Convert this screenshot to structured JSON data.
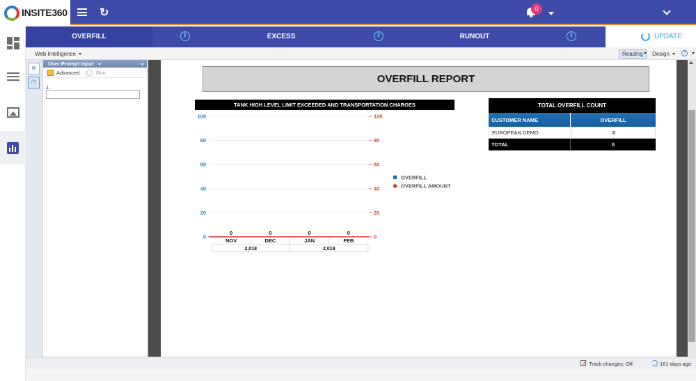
{
  "app": {
    "logo_text": "INSITE360",
    "notification_count": "0"
  },
  "tabs": [
    {
      "label": "OVERFILL"
    },
    {
      "label": "EXCESS"
    },
    {
      "label": "RUNOUT"
    }
  ],
  "update_label": "UPDATE",
  "bi_toolbar": {
    "app_name": "Web Intelligence",
    "reading_label": "Reading",
    "design_label": "Design",
    "help_symbol": "?"
  },
  "prompt_panel": {
    "title": "User Prompt Input",
    "advanced_label": "Advanced",
    "run_label": "Run",
    "prompt_number": "1",
    "prompt_value": ""
  },
  "report": {
    "title": "OVERFILL REPORT"
  },
  "chart_data": {
    "type": "bar",
    "title": "TANK HIGH LEVEL LIMIT EXCEEDED AND TRANSPORTATION CHARGES",
    "categories": [
      "NOV",
      "DEC",
      "JAN",
      "FEB"
    ],
    "category_groups": [
      {
        "label": "2,018",
        "span": 2
      },
      {
        "label": "2,019",
        "span": 2
      }
    ],
    "series": [
      {
        "name": "OVERFILL",
        "values": [
          0,
          0,
          0,
          0
        ],
        "axis": "left",
        "color": "#1f6fb2"
      },
      {
        "name": "OVERFILL AMOUNT",
        "values": [
          0,
          0,
          0,
          0
        ],
        "axis": "right",
        "color": "#d9342b"
      }
    ],
    "data_labels": [
      "0",
      "0",
      "0",
      "0"
    ],
    "ylim": [
      0,
      100
    ],
    "y2lim": [
      0,
      100
    ],
    "y_ticks": [
      "0",
      "20",
      "40",
      "60",
      "80",
      "100"
    ],
    "y2_ticks": [
      "0",
      "20",
      "40",
      "60",
      "80",
      "100"
    ],
    "legend": "right",
    "grid": true
  },
  "total_table": {
    "title": "TOTAL OVERFILL COUNT",
    "columns": [
      "CUSTOMER NAME",
      "OVERFILL"
    ],
    "rows": [
      {
        "name": "EUROPEAN DEMO",
        "value": "0"
      }
    ],
    "total": {
      "label": "TOTAL",
      "value": "0"
    }
  },
  "status_bar": {
    "track_changes": "Track changes: Off",
    "last_refresh": "161 days ago"
  },
  "colors": {
    "header": "#3f4ba8",
    "accent": "#e8892f",
    "update": "#3aa6d8",
    "table_header": "#1f72b8"
  }
}
